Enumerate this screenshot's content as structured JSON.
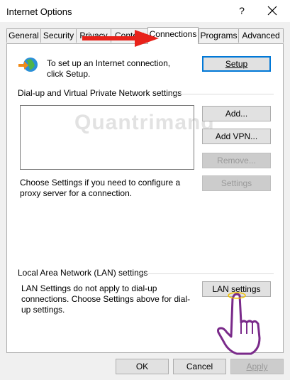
{
  "window": {
    "title": "Internet Options",
    "help_glyph": "?",
    "close_glyph": "✕"
  },
  "tabs": [
    {
      "label": "General"
    },
    {
      "label": "Security"
    },
    {
      "label": "Privacy"
    },
    {
      "label": "Content"
    },
    {
      "label": "Connections"
    },
    {
      "label": "Programs"
    },
    {
      "label": "Advanced"
    }
  ],
  "active_tab": "Connections",
  "setup": {
    "description": "To set up an Internet connection, click Setup.",
    "button": "Setup"
  },
  "dialup": {
    "heading": "Dial-up and Virtual Private Network settings",
    "add_button": "Add...",
    "add_vpn_button": "Add VPN...",
    "remove_button": "Remove...",
    "settings_button": "Settings",
    "proxy_text": "Choose Settings if you need to configure a proxy server for a connection."
  },
  "lan": {
    "heading": "Local Area Network (LAN) settings",
    "text": "LAN Settings do not apply to dial-up connections. Choose Settings above for dial-up settings.",
    "button": "LAN settings"
  },
  "footer": {
    "ok": "OK",
    "cancel": "Cancel",
    "apply": "Apply"
  },
  "watermark": "Quantrimang",
  "colors": {
    "arrow": "#e8221a",
    "hand": "#7a2a8a",
    "default_border": "#0078d7"
  }
}
